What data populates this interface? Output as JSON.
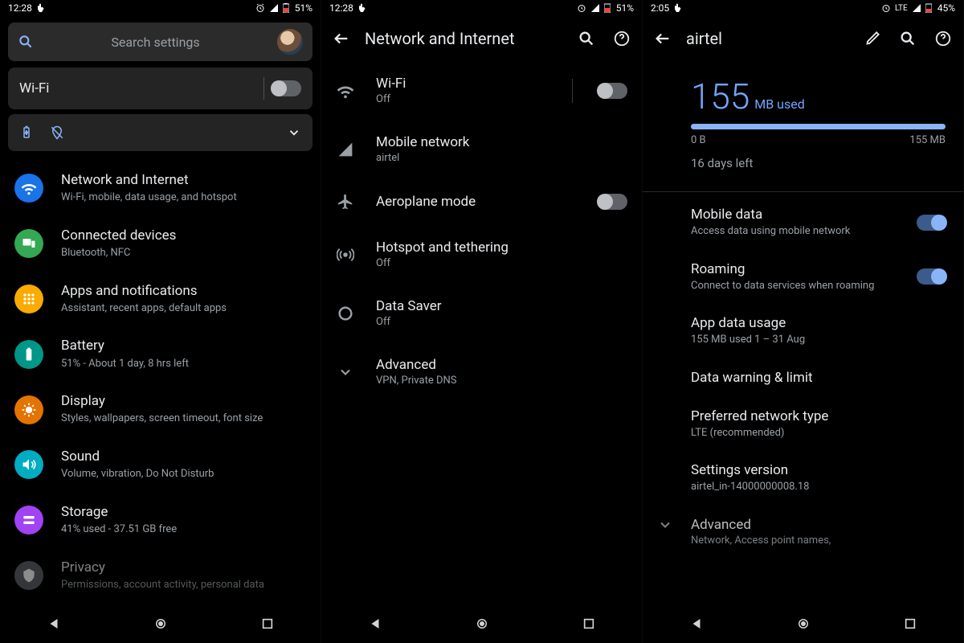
{
  "panel1": {
    "status": {
      "time": "12:28",
      "battery": "51%"
    },
    "search_placeholder": "Search settings",
    "wifi_label": "Wi-Fi",
    "items": [
      {
        "title": "Network and Internet",
        "sub": "Wi-Fi, mobile, data usage, and hotspot"
      },
      {
        "title": "Connected devices",
        "sub": "Bluetooth, NFC"
      },
      {
        "title": "Apps and notifications",
        "sub": "Assistant, recent apps, default apps"
      },
      {
        "title": "Battery",
        "sub": "51% - About 1 day, 8 hrs left"
      },
      {
        "title": "Display",
        "sub": "Styles, wallpapers, screen timeout, font size"
      },
      {
        "title": "Sound",
        "sub": "Volume, vibration, Do Not Disturb"
      },
      {
        "title": "Storage",
        "sub": "41% used - 37.51 GB free"
      },
      {
        "title": "Privacy",
        "sub": "Permissions, account activity, personal data"
      }
    ]
  },
  "panel2": {
    "status": {
      "time": "12:28",
      "battery": "51%"
    },
    "title": "Network and Internet",
    "items": {
      "wifi": {
        "title": "Wi-Fi",
        "sub": "Off"
      },
      "mobile": {
        "title": "Mobile network",
        "sub": "airtel"
      },
      "airplane": {
        "title": "Aeroplane mode"
      },
      "hotspot": {
        "title": "Hotspot and tethering",
        "sub": "Off"
      },
      "datasaver": {
        "title": "Data Saver",
        "sub": "Off"
      },
      "advanced": {
        "title": "Advanced",
        "sub": "VPN, Private DNS"
      }
    }
  },
  "panel3": {
    "status": {
      "time": "2:05",
      "net": "LTE",
      "battery": "45%"
    },
    "title": "airtel",
    "usage": {
      "value": "155",
      "unit": "MB used",
      "min": "0 B",
      "max": "155 MB",
      "days": "16 days left"
    },
    "items": {
      "mobile_data": {
        "title": "Mobile data",
        "sub": "Access data using mobile network"
      },
      "roaming": {
        "title": "Roaming",
        "sub": "Connect to data services when roaming"
      },
      "app_usage": {
        "title": "App data usage",
        "sub": "155 MB used 1 – 31 Aug"
      },
      "warning": {
        "title": "Data warning & limit"
      },
      "pref": {
        "title": "Preferred network type",
        "sub": "LTE (recommended)"
      },
      "ver": {
        "title": "Settings version",
        "sub": "airtel_in-14000000008.18"
      },
      "advanced": {
        "title": "Advanced",
        "sub": "Network, Access point names,"
      }
    }
  }
}
